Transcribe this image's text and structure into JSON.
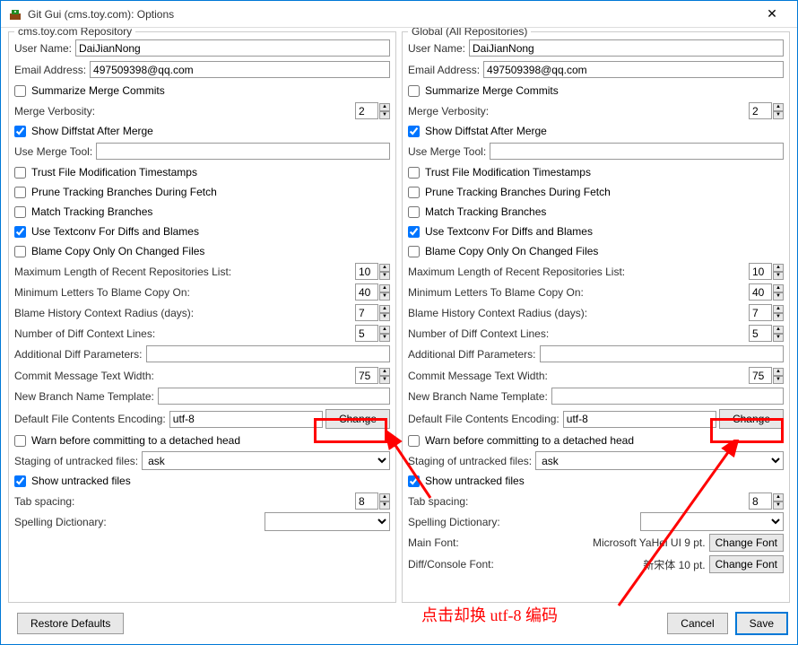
{
  "window": {
    "title": "Git Gui (cms.toy.com): Options"
  },
  "repo": {
    "section_title": "cms.toy.com Repository",
    "user_name_label": "User Name:",
    "user_name": "DaiJianNong",
    "email_label": "Email Address:",
    "email": "497509398@qq.com",
    "summarize_merge": "Summarize Merge Commits",
    "merge_verbosity_label": "Merge Verbosity:",
    "merge_verbosity": "2",
    "show_diffstat": "Show Diffstat After Merge",
    "use_merge_tool_label": "Use Merge Tool:",
    "use_merge_tool": "",
    "trust_timestamps": "Trust File Modification Timestamps",
    "prune_tracking": "Prune Tracking Branches During Fetch",
    "match_tracking": "Match Tracking Branches",
    "use_textconv": "Use Textconv For Diffs and Blames",
    "blame_copy": "Blame Copy Only On Changed Files",
    "max_recent_label": "Maximum Length of Recent Repositories List:",
    "max_recent": "10",
    "min_blame_label": "Minimum Letters To Blame Copy On:",
    "min_blame": "40",
    "blame_history_label": "Blame History Context Radius (days):",
    "blame_history": "7",
    "num_diff_label": "Number of Diff Context Lines:",
    "num_diff": "5",
    "add_diff_label": "Additional Diff Parameters:",
    "add_diff": "",
    "commit_width_label": "Commit Message Text Width:",
    "commit_width": "75",
    "new_branch_label": "New Branch Name Template:",
    "new_branch": "",
    "encoding_label": "Default File Contents Encoding:",
    "encoding": "utf-8",
    "change_btn": "Change",
    "warn_detached": "Warn before committing to a detached head",
    "staging_label": "Staging of untracked files:",
    "staging": "ask",
    "show_untracked": "Show untracked files",
    "tab_spacing_label": "Tab spacing:",
    "tab_spacing": "8",
    "spell_label": "Spelling Dictionary:",
    "spell": ""
  },
  "global": {
    "section_title": "Global (All Repositories)",
    "user_name_label": "User Name:",
    "user_name": "DaiJianNong",
    "email_label": "Email Address:",
    "email": "497509398@qq.com",
    "summarize_merge": "Summarize Merge Commits",
    "merge_verbosity_label": "Merge Verbosity:",
    "merge_verbosity": "2",
    "show_diffstat": "Show Diffstat After Merge",
    "use_merge_tool_label": "Use Merge Tool:",
    "use_merge_tool": "",
    "trust_timestamps": "Trust File Modification Timestamps",
    "prune_tracking": "Prune Tracking Branches During Fetch",
    "match_tracking": "Match Tracking Branches",
    "use_textconv": "Use Textconv For Diffs and Blames",
    "blame_copy": "Blame Copy Only On Changed Files",
    "max_recent_label": "Maximum Length of Recent Repositories List:",
    "max_recent": "10",
    "min_blame_label": "Minimum Letters To Blame Copy On:",
    "min_blame": "40",
    "blame_history_label": "Blame History Context Radius (days):",
    "blame_history": "7",
    "num_diff_label": "Number of Diff Context Lines:",
    "num_diff": "5",
    "add_diff_label": "Additional Diff Parameters:",
    "add_diff": "",
    "commit_width_label": "Commit Message Text Width:",
    "commit_width": "75",
    "new_branch_label": "New Branch Name Template:",
    "new_branch": "",
    "encoding_label": "Default File Contents Encoding:",
    "encoding": "utf-8",
    "change_btn": "Change",
    "warn_detached": "Warn before committing to a detached head",
    "staging_label": "Staging of untracked files:",
    "staging": "ask",
    "show_untracked": "Show untracked files",
    "tab_spacing_label": "Tab spacing:",
    "tab_spacing": "8",
    "spell_label": "Spelling Dictionary:",
    "spell": "",
    "main_font_label": "Main Font:",
    "main_font": "Microsoft YaHei UI 9 pt.",
    "change_font_btn": "Change Font",
    "diff_font_label": "Diff/Console Font:",
    "diff_font": "新宋体 10 pt."
  },
  "footer": {
    "restore": "Restore Defaults",
    "cancel": "Cancel",
    "save": "Save"
  },
  "annotation": "点击却换 utf-8 编码"
}
